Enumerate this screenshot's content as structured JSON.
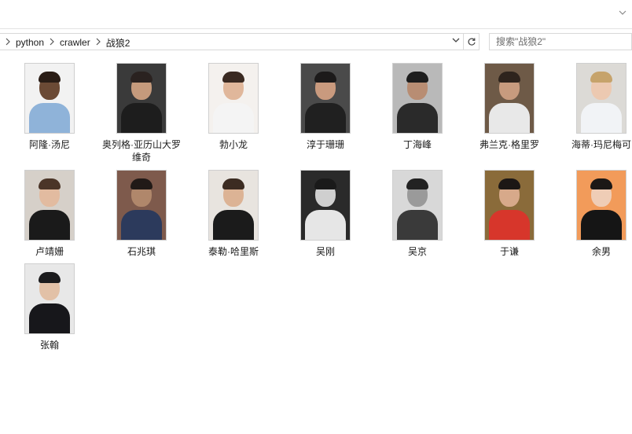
{
  "window": {
    "ribbon_toggle_icon": "chevron-down-icon"
  },
  "address_bar": {
    "breadcrumbs": [
      "python",
      "crawler",
      "战狼2"
    ],
    "separator_icon": "chevron-right-icon",
    "dropdown_icon": "chevron-down-icon",
    "refresh_icon": "refresh-icon"
  },
  "search": {
    "placeholder": "搜索\"战狼2\""
  },
  "files": [
    {
      "name": "阿隆·汤尼",
      "bg": "#f2f2f2",
      "skin": "#6b4a35",
      "hair": "#2a1d16",
      "cloth": "#8fb3d9"
    },
    {
      "name": "奥列格·亚历山大罗维奇",
      "bg": "#3a3a3a",
      "skin": "#c59a7c",
      "hair": "#2a2220",
      "cloth": "#1d1d1d"
    },
    {
      "name": "勃小龙",
      "bg": "#f4f1ee",
      "skin": "#e0b79b",
      "hair": "#3a2a22",
      "cloth": "#f4f4f4"
    },
    {
      "name": "淳于珊珊",
      "bg": "#4a4a4a",
      "skin": "#c99a7e",
      "hair": "#1c1a1a",
      "cloth": "#202020"
    },
    {
      "name": "丁海峰",
      "bg": "#b9b9b9",
      "skin": "#b88d73",
      "hair": "#1d1d1d",
      "cloth": "#2a2a2a"
    },
    {
      "name": "弗兰克·格里罗",
      "bg": "#6e5a47",
      "skin": "#c79b7e",
      "hair": "#2e241d",
      "cloth": "#e8e8e8"
    },
    {
      "name": "海蒂·玛尼梅可",
      "bg": "#dcdad6",
      "skin": "#ecc9b1",
      "hair": "#c6a36b",
      "cloth": "#f1f3f6"
    },
    {
      "name": "卢靖姗",
      "bg": "#d6d0c9",
      "skin": "#e2bba0",
      "hair": "#4b3528",
      "cloth": "#1a1a1a"
    },
    {
      "name": "石兆琪",
      "bg": "#7e5a4c",
      "skin": "#b0876b",
      "hair": "#211a17",
      "cloth": "#2c3a5c"
    },
    {
      "name": "泰勒·哈里斯",
      "bg": "#e8e4df",
      "skin": "#dcb395",
      "hair": "#3c2c22",
      "cloth": "#1b1b1b"
    },
    {
      "name": "吴刚",
      "bg": "#2a2a2a",
      "skin": "#cfcfcf",
      "hair": "#1a1a1a",
      "cloth": "#e6e6e6"
    },
    {
      "name": "吴京",
      "bg": "#d8d8d8",
      "skin": "#9a9a9a",
      "hair": "#222222",
      "cloth": "#3a3a3a"
    },
    {
      "name": "于谦",
      "bg": "#8a6b3a",
      "skin": "#d7a98a",
      "hair": "#1c1715",
      "cloth": "#d7362b"
    },
    {
      "name": "余男",
      "bg": "#f29b5a",
      "skin": "#efcdb6",
      "hair": "#1c1816",
      "cloth": "#151515"
    },
    {
      "name": "张翰",
      "bg": "#e8e8e8",
      "skin": "#e2c1a7",
      "hair": "#1b1b1d",
      "cloth": "#17171b"
    }
  ]
}
